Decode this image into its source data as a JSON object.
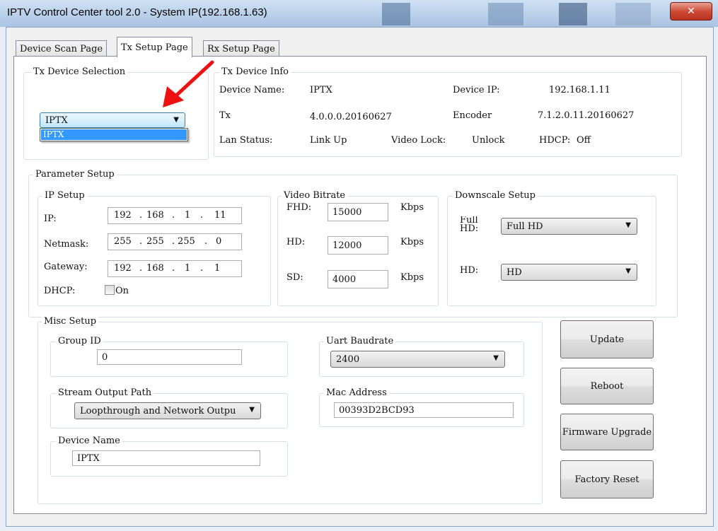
{
  "window": {
    "title": "IPTV Control Center tool 2.0 - System IP(192.168.1.63)",
    "close_glyph": "✕"
  },
  "tabs": [
    {
      "label": "Device Scan Page"
    },
    {
      "label": "Tx Setup Page"
    },
    {
      "label": "Rx Setup Page"
    }
  ],
  "tx_device_selection": {
    "title": "Tx Device Selection",
    "selected": "IPTX",
    "options": [
      "IPTX"
    ]
  },
  "tx_device_info": {
    "title": "Tx Device Info",
    "device_name_label": "Device Name:",
    "device_name": "IPTX",
    "device_ip_label": "Device IP:",
    "device_ip": "192.168.1.11",
    "tx_label": "Tx",
    "tx_version": "4.0.0.0.20160627",
    "encoder_label": "Encoder",
    "encoder_version": "7.1.2.0.11.20160627",
    "lan_status_label": "Lan Status:",
    "lan_status": "Link Up",
    "video_lock_label": "Video Lock:",
    "video_lock": "Unlock",
    "hdcp_label": "HDCP:",
    "hdcp": "Off"
  },
  "parameter_setup": {
    "title": "Parameter Setup",
    "ip_setup": {
      "title": "IP Setup",
      "ip_label": "IP:",
      "ip": [
        "192",
        "168",
        "1",
        "11"
      ],
      "netmask_label": "Netmask:",
      "netmask": [
        "255",
        "255",
        "255",
        "0"
      ],
      "gateway_label": "Gateway:",
      "gateway": [
        "192",
        "168",
        "1",
        "1"
      ],
      "dhcp_label": "DHCP:",
      "dhcp_checkbox_label": "On",
      "dhcp_checked": false
    },
    "video_bitrate": {
      "title": "Video Bitrate",
      "fhd_label": "FHD:",
      "fhd": "15000",
      "hd_label": "HD:",
      "hd": "12000",
      "sd_label": "SD:",
      "sd": "4000",
      "unit": "Kbps"
    },
    "downscale_setup": {
      "title": "Downscale Setup",
      "full_hd_label": "Full\nHD:",
      "full_hd": "Full HD",
      "hd_label": "HD:",
      "hd": "HD"
    }
  },
  "misc_setup": {
    "title": "Misc Setup",
    "group_id_title": "Group ID",
    "group_id": "0",
    "uart_baudrate_title": "Uart Baudrate",
    "uart_baudrate": "2400",
    "stream_output_path_title": "Stream Output Path",
    "stream_output_path": "Loopthrough and Network Outpu",
    "mac_address_title": "Mac Address",
    "mac_address": "00393D2BCD93",
    "device_name_title": "Device Name",
    "device_name": "IPTX"
  },
  "buttons": {
    "update": "Update",
    "reboot": "Reboot",
    "firmware_upgrade": "Firmware Upgrade",
    "factory_reset": "Factory Reset"
  },
  "colors": {
    "dropdown_highlight": "#3399ff",
    "annotation_arrow": "#ee1111"
  }
}
